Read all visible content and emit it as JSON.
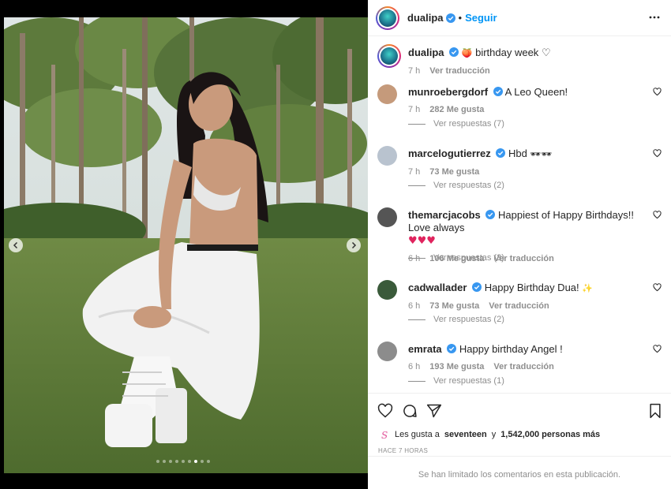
{
  "post": {
    "author": "dualipa",
    "follow_label": "Seguir",
    "caption_text": "birthday week",
    "caption_emoji": "🍑",
    "caption_heart": "♡",
    "caption_time": "7 h",
    "caption_translate": "Ver traducción"
  },
  "media": {
    "slide_count": 9,
    "active_slide": 7
  },
  "comments": [
    {
      "user": "munroebergdorf",
      "text": "A Leo Queen!",
      "time": "7 h",
      "likes": "282 Me gusta",
      "translate": "",
      "replies": "Ver respuestas (7)",
      "avatar_color": "#c59a7b"
    },
    {
      "user": "marcelogutierrez",
      "text": "Hbd",
      "emojis": "🕶🕶",
      "time": "7 h",
      "likes": "73 Me gusta",
      "translate": "",
      "replies": "Ver respuestas (2)",
      "avatar_color": "#b9c3cf"
    },
    {
      "user": "themarcjacobs",
      "text": "Happiest of Happy Birthdays!! Love always",
      "hearts": "♥♥♥",
      "time": "6 h",
      "likes": "106 Me gusta",
      "translate": "Ver traducción",
      "replies": "Ver respuestas (3)",
      "avatar_color": "#555555"
    },
    {
      "user": "cadwallader",
      "text": "Happy Birthday Dua!",
      "emojis": "✨",
      "time": "6 h",
      "likes": "73 Me gusta",
      "translate": "Ver traducción",
      "replies": "Ver respuestas (2)",
      "avatar_color": "#3a5a3a"
    },
    {
      "user": "emrata",
      "text": "Happy birthday Angel !",
      "time": "6 h",
      "likes": "193 Me gusta",
      "translate": "Ver traducción",
      "replies": "Ver respuestas (1)",
      "avatar_color": "#8c8c8c"
    }
  ],
  "likes": {
    "prefix": "Les gusta a",
    "user": "seventeen",
    "conj": "y",
    "count": "1,542,000 personas más"
  },
  "time_ago": "HACE 7 HORAS",
  "comments_limited": "Se han limitado los comentarios en esta publicación.",
  "colors": {
    "accent": "#0095f6",
    "verified": "#3897f0",
    "muted": "#8e8e8e"
  }
}
